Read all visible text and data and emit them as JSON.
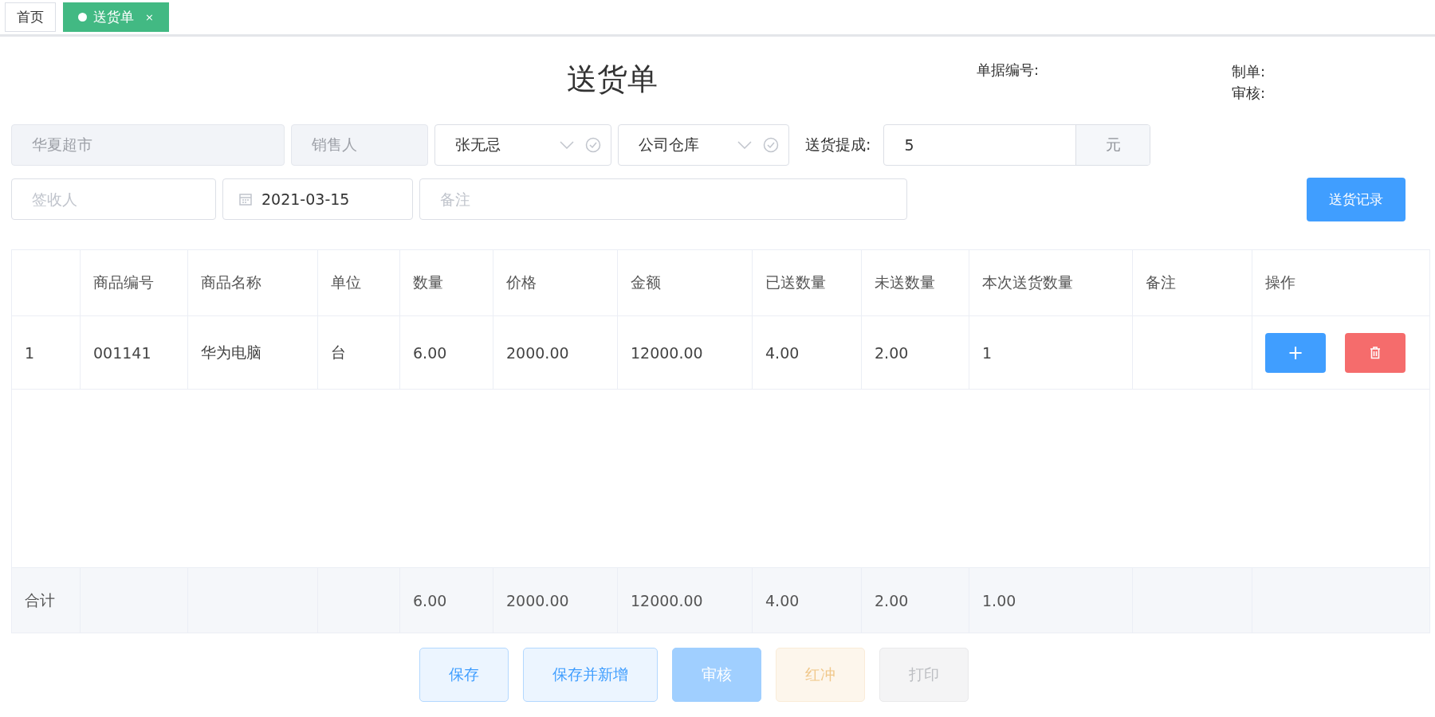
{
  "tabs": [
    {
      "label": "首页",
      "selected": false
    },
    {
      "label": "送货单",
      "selected": true,
      "close_glyph": "×"
    }
  ],
  "header": {
    "title": "送货单",
    "doc_number_label": "单据编号:",
    "maker_label": "制单:",
    "reviewer_label": "审核:"
  },
  "form": {
    "customer": {
      "value": "华夏超市",
      "disabled": true
    },
    "salesperson": {
      "placeholder": "销售人",
      "disabled": true
    },
    "deliverer": {
      "value": "张无忌"
    },
    "warehouse": {
      "value": "公司仓库"
    },
    "commission": {
      "label": "送货提成:",
      "value": "5",
      "suffix": "元"
    },
    "receiver": {
      "placeholder": "签收人"
    },
    "date": {
      "value": "2021-03-15"
    },
    "remark": {
      "placeholder": "备注"
    },
    "record_button": "送货记录"
  },
  "table": {
    "columns": {
      "code": "商品编号",
      "name": "商品名称",
      "unit": "单位",
      "quantity": "数量",
      "price": "价格",
      "amount": "金额",
      "delivered": "已送数量",
      "undelivered": "未送数量",
      "this_delivery": "本次送货数量",
      "remark": "备注",
      "actions": "操作"
    },
    "rows": [
      {
        "index": "1",
        "code": "001141",
        "name": "华为电脑",
        "unit": "台",
        "quantity": "6.00",
        "price": "2000.00",
        "amount": "12000.00",
        "delivered": "4.00",
        "undelivered": "2.00",
        "this_delivery": "1",
        "add_glyph": "+"
      }
    ],
    "footer": {
      "index": "合计",
      "quantity": "6.00",
      "price": "2000.00",
      "amount": "12000.00",
      "delivered": "4.00",
      "undelivered": "2.00",
      "this_delivery": "1.00"
    }
  },
  "actions": [
    {
      "label": "保存",
      "kind": "primary-plain",
      "disabled": false
    },
    {
      "label": "保存并新增",
      "kind": "primary-plain",
      "disabled": false
    },
    {
      "label": "审核",
      "kind": "primary",
      "disabled": true
    },
    {
      "label": "红冲",
      "kind": "warning-plain",
      "disabled": true
    },
    {
      "label": "打印",
      "kind": "default",
      "disabled": true
    }
  ]
}
